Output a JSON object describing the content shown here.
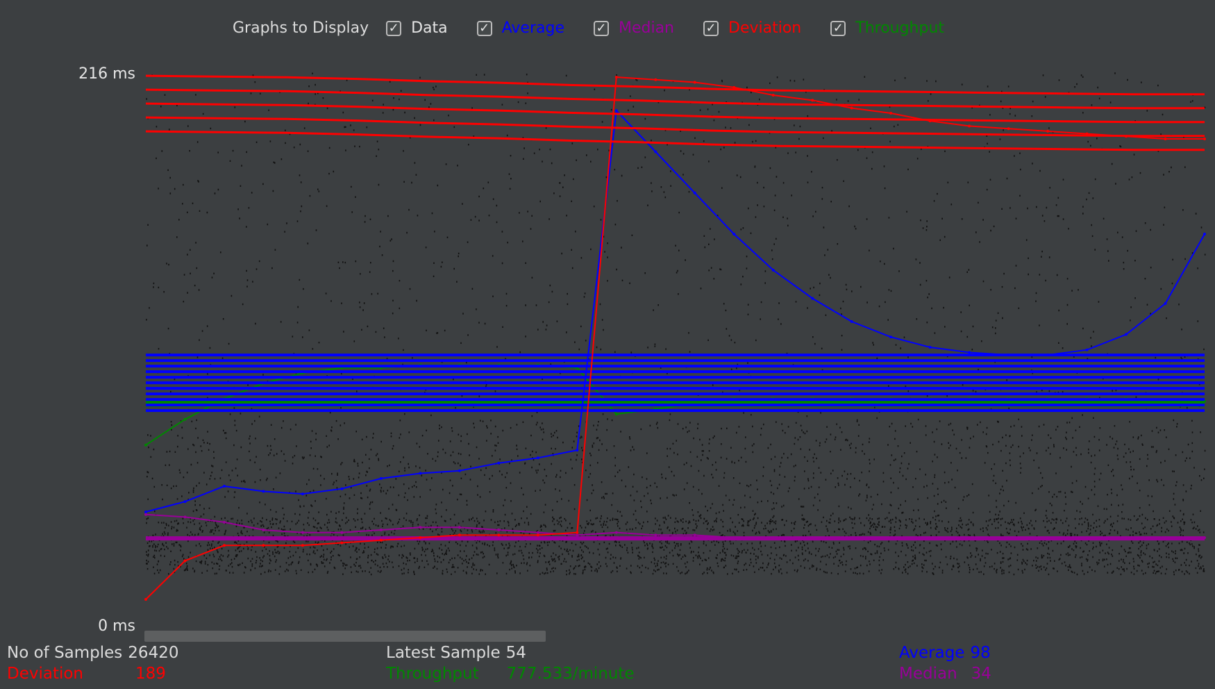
{
  "toolbar": {
    "title": "Graphs to Display",
    "options": [
      {
        "label": "Data",
        "checked": true,
        "color": "#e6e6e6"
      },
      {
        "label": "Average",
        "checked": true,
        "color": "#0000ff"
      },
      {
        "label": "Median",
        "checked": true,
        "color": "#990099"
      },
      {
        "label": "Deviation",
        "checked": true,
        "color": "#ff0000"
      },
      {
        "label": "Throughput",
        "checked": true,
        "color": "#008800"
      }
    ]
  },
  "axis": {
    "y_max_label": "216  ms",
    "y_min_label": "0  ms"
  },
  "colors": {
    "background": "#3c3f41",
    "data": "#111111",
    "average": "#0000ff",
    "median": "#990099",
    "deviation": "#ff0000",
    "throughput": "#008800"
  },
  "stats": {
    "samples_label": "No of Samples",
    "samples_value": "26420",
    "latest_label": "Latest Sample",
    "latest_value": "54",
    "average_label": "Average",
    "average_value": "98",
    "deviation_label": "Deviation",
    "deviation_value": "189",
    "throughput_label": "Throughput",
    "throughput_value": "777.533/minute",
    "median_label": "Median",
    "median_value": "34"
  },
  "chart_data": {
    "type": "scatter",
    "ylim": [
      0,
      216
    ],
    "series": [
      {
        "name": "Average",
        "values": [
          44,
          48,
          54,
          52,
          51,
          53,
          57,
          59,
          60,
          63,
          65,
          68,
          200,
          184,
          168,
          152,
          138,
          127,
          118,
          112,
          108,
          106,
          105,
          105,
          107,
          113,
          125,
          152
        ]
      },
      {
        "name": "Median",
        "values": [
          43,
          42,
          40,
          37,
          36,
          36,
          37,
          38,
          38,
          37,
          36,
          35,
          36,
          35,
          35,
          34,
          34,
          34,
          34,
          34,
          34,
          34,
          34,
          34,
          34,
          34,
          34,
          34
        ]
      },
      {
        "name": "Deviation",
        "values": [
          10,
          25,
          31,
          31,
          31,
          32,
          33,
          34,
          35,
          35,
          35,
          36,
          213,
          212,
          211,
          209,
          206,
          204,
          201,
          199,
          196,
          194,
          193,
          192,
          191,
          190,
          189,
          189
        ]
      },
      {
        "name": "Throughput",
        "values": [
          70,
          80,
          88,
          94,
          98,
          100,
          100,
          101,
          101,
          101,
          101,
          100,
          82,
          84,
          86,
          88,
          88,
          88,
          88,
          88,
          88,
          88,
          88,
          88,
          88,
          88,
          87,
          87
        ]
      }
    ]
  }
}
